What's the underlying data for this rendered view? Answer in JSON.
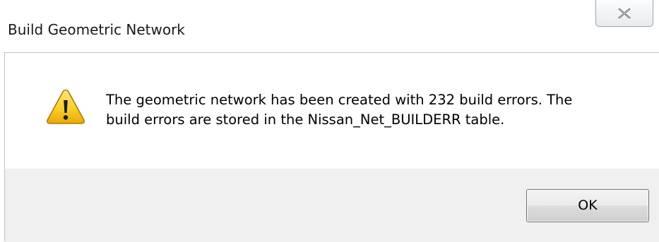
{
  "window": {
    "title": "Build Geometric Network"
  },
  "dialog": {
    "icon": "warning-icon",
    "message_line1": "The geometric network has been created with 232 build errors. The",
    "message_line2": "build errors are stored in the Nissan_Net_BUILDERR table."
  },
  "buttons": {
    "ok_label": "OK",
    "close_icon": "close-icon"
  },
  "colors": {
    "footer_background": "#f0f0f0",
    "warning_yellow": "#f5c722"
  }
}
